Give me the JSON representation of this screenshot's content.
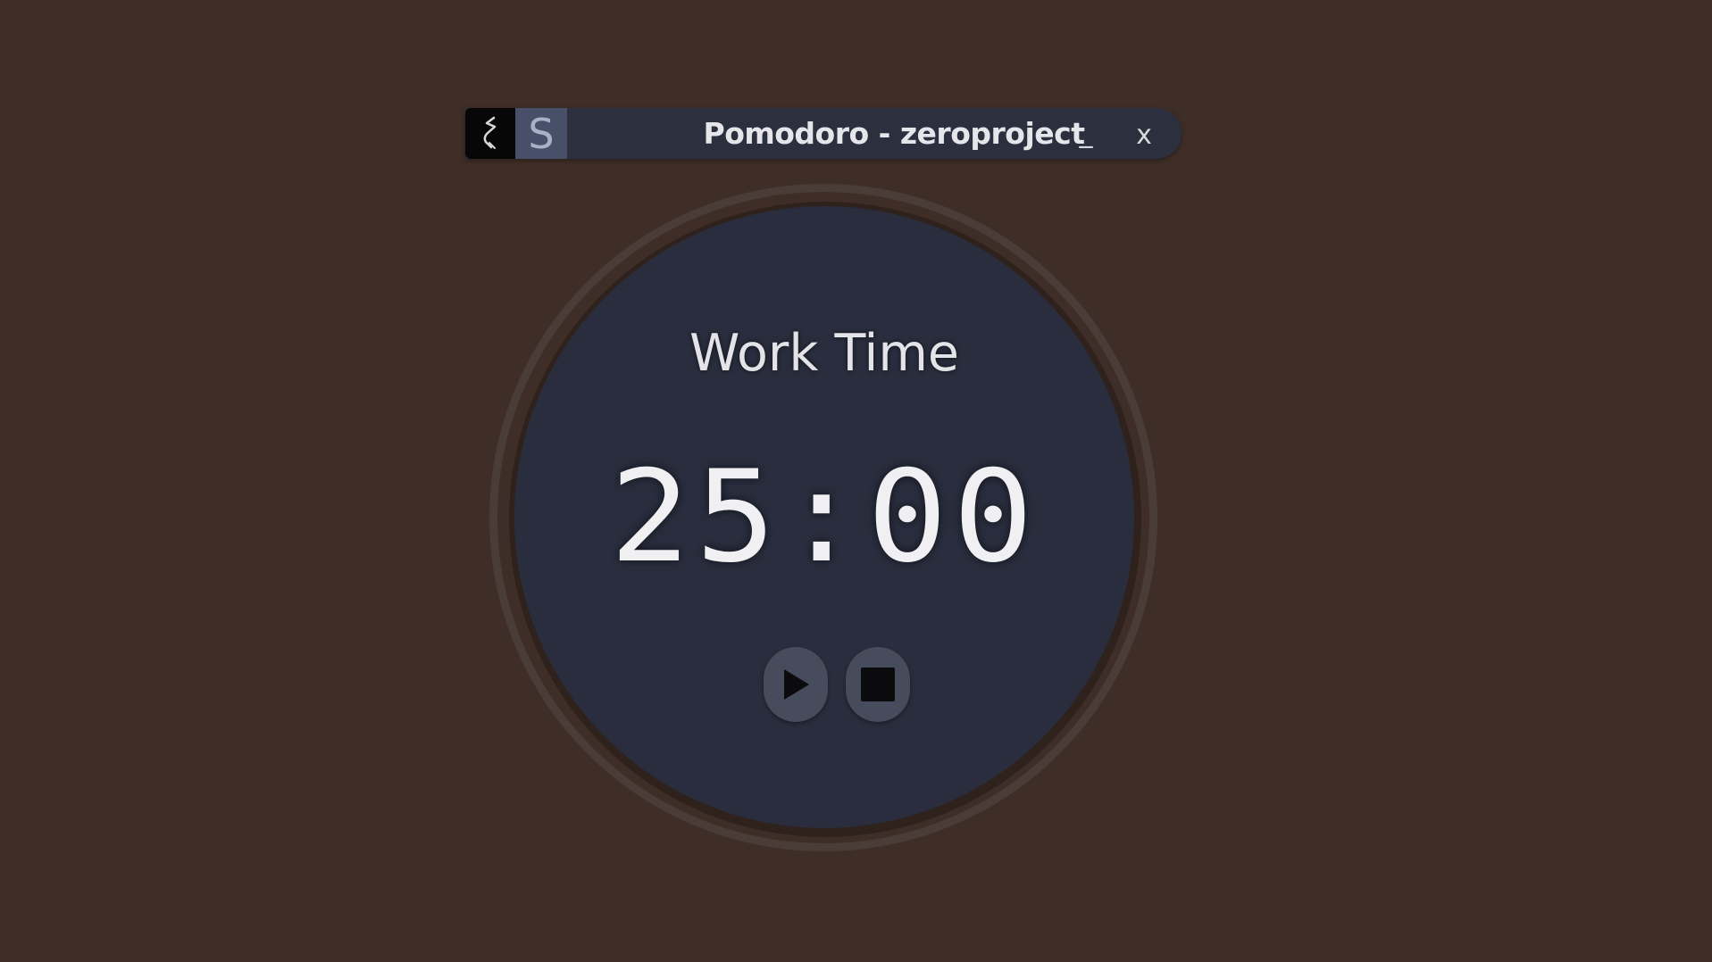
{
  "window": {
    "title": "Pomodoro - zeroproject",
    "app_icon_letter": "S",
    "minimize_label": "_",
    "close_label": "x"
  },
  "timer": {
    "mode": "Work Time",
    "display": "25:00"
  },
  "controls": {
    "play_icon": "play-icon",
    "stop_icon": "stop-icon"
  },
  "colors": {
    "background": "#3f2e27",
    "titlebar": "#2b2f3e",
    "face": "#292d3d",
    "button": "#474c5d",
    "text": "#e6e6ea"
  }
}
